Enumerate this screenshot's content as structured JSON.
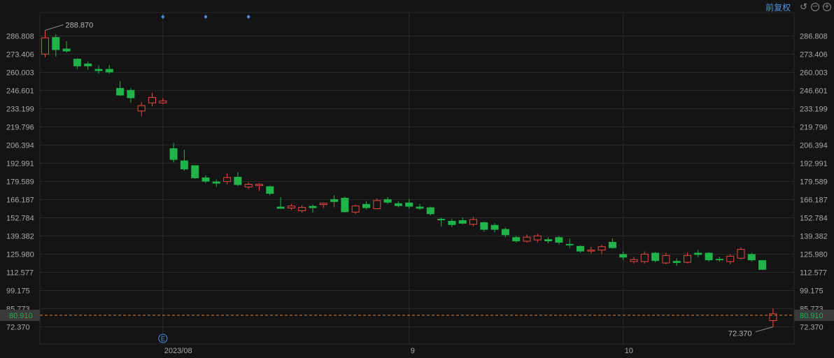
{
  "toolbar": {
    "mode_label": "前复权",
    "reset_icon": "undo-icon",
    "zoom_out_icon": "zoom-out-icon",
    "zoom_in_icon": "zoom-in-icon"
  },
  "chart_data": {
    "type": "candlestick",
    "ylim": [
      68,
      300
    ],
    "y_ticks": [
      "286.808",
      "273.406",
      "260.003",
      "246.601",
      "233.199",
      "219.796",
      "206.394",
      "192.991",
      "179.589",
      "166.187",
      "152.784",
      "139.382",
      "125.980",
      "112.577",
      "99.175",
      "85.773",
      "72.370"
    ],
    "x_tick_labels": [
      {
        "label": "2023/08",
        "index": 11
      },
      {
        "label": "9",
        "index": 34
      },
      {
        "label": "10",
        "index": 54
      }
    ],
    "current_price": "80.910",
    "max_label": "288.870",
    "min_label": "72.370",
    "event_marker": "E",
    "event_marker_index": 11,
    "top_markers": [
      11,
      15,
      19
    ],
    "colors": {
      "up": "#e8483f",
      "down": "#1fb34a",
      "grid": "#2a2a2a",
      "price_line": "#e07b3a",
      "marker": "#4a8fe8"
    },
    "candles": [
      {
        "o": 273.5,
        "h": 291.0,
        "l": 271.0,
        "c": 285.5
      },
      {
        "o": 286.0,
        "h": 288.0,
        "l": 271.5,
        "c": 276.5
      },
      {
        "o": 277.5,
        "h": 283.0,
        "l": 274.5,
        "c": 275.5
      },
      {
        "o": 270.0,
        "h": 270.5,
        "l": 262.5,
        "c": 264.5
      },
      {
        "o": 266.5,
        "h": 268.0,
        "l": 262.0,
        "c": 264.5
      },
      {
        "o": 262.5,
        "h": 265.0,
        "l": 259.0,
        "c": 261.0
      },
      {
        "o": 262.5,
        "h": 265.5,
        "l": 259.0,
        "c": 260.0
      },
      {
        "o": 248.5,
        "h": 253.5,
        "l": 242.5,
        "c": 243.0
      },
      {
        "o": 247.0,
        "h": 248.5,
        "l": 237.5,
        "c": 241.0
      },
      {
        "o": 231.5,
        "h": 238.0,
        "l": 227.5,
        "c": 235.5
      },
      {
        "o": 237.5,
        "h": 245.0,
        "l": 235.0,
        "c": 241.5
      },
      {
        "o": 237.5,
        "h": 241.0,
        "l": 236.5,
        "c": 239.0
      },
      {
        "o": 204.0,
        "h": 208.0,
        "l": 193.5,
        "c": 195.5
      },
      {
        "o": 195.0,
        "h": 203.0,
        "l": 187.5,
        "c": 188.5
      },
      {
        "o": 191.5,
        "h": 191.5,
        "l": 181.5,
        "c": 182.0
      },
      {
        "o": 182.5,
        "h": 184.0,
        "l": 178.5,
        "c": 179.5
      },
      {
        "o": 179.5,
        "h": 181.0,
        "l": 175.5,
        "c": 178.0
      },
      {
        "o": 179.5,
        "h": 185.5,
        "l": 177.5,
        "c": 182.5
      },
      {
        "o": 183.0,
        "h": 186.5,
        "l": 176.0,
        "c": 177.0
      },
      {
        "o": 175.5,
        "h": 179.0,
        "l": 174.0,
        "c": 177.5
      },
      {
        "o": 176.5,
        "h": 178.5,
        "l": 172.5,
        "c": 177.5
      },
      {
        "o": 176.0,
        "h": 176.5,
        "l": 169.5,
        "c": 170.5
      },
      {
        "o": 161.0,
        "h": 168.0,
        "l": 160.0,
        "c": 159.5
      },
      {
        "o": 160.0,
        "h": 163.0,
        "l": 158.5,
        "c": 161.5
      },
      {
        "o": 158.0,
        "h": 162.0,
        "l": 156.5,
        "c": 160.5
      },
      {
        "o": 161.5,
        "h": 162.5,
        "l": 156.5,
        "c": 160.0
      },
      {
        "o": 162.5,
        "h": 164.0,
        "l": 160.0,
        "c": 163.5
      },
      {
        "o": 166.5,
        "h": 169.5,
        "l": 160.5,
        "c": 164.5
      },
      {
        "o": 167.5,
        "h": 168.5,
        "l": 156.5,
        "c": 157.0
      },
      {
        "o": 157.0,
        "h": 162.5,
        "l": 155.5,
        "c": 161.5
      },
      {
        "o": 163.0,
        "h": 165.0,
        "l": 159.0,
        "c": 160.0
      },
      {
        "o": 159.5,
        "h": 167.0,
        "l": 159.0,
        "c": 165.5
      },
      {
        "o": 166.5,
        "h": 168.0,
        "l": 163.0,
        "c": 164.0
      },
      {
        "o": 163.5,
        "h": 165.0,
        "l": 160.5,
        "c": 161.5
      },
      {
        "o": 164.0,
        "h": 166.5,
        "l": 159.5,
        "c": 161.0
      },
      {
        "o": 161.0,
        "h": 163.0,
        "l": 158.5,
        "c": 159.5
      },
      {
        "o": 160.5,
        "h": 161.0,
        "l": 154.5,
        "c": 155.5
      },
      {
        "o": 152.0,
        "h": 153.0,
        "l": 146.5,
        "c": 151.0
      },
      {
        "o": 150.5,
        "h": 152.0,
        "l": 146.0,
        "c": 147.5
      },
      {
        "o": 151.0,
        "h": 153.0,
        "l": 148.0,
        "c": 148.5
      },
      {
        "o": 148.0,
        "h": 153.5,
        "l": 146.5,
        "c": 151.5
      },
      {
        "o": 149.5,
        "h": 150.0,
        "l": 142.5,
        "c": 144.0
      },
      {
        "o": 147.5,
        "h": 149.0,
        "l": 142.0,
        "c": 144.0
      },
      {
        "o": 144.5,
        "h": 145.5,
        "l": 138.5,
        "c": 140.0
      },
      {
        "o": 138.5,
        "h": 139.5,
        "l": 134.5,
        "c": 135.5
      },
      {
        "o": 135.5,
        "h": 140.5,
        "l": 134.5,
        "c": 138.5
      },
      {
        "o": 136.5,
        "h": 141.0,
        "l": 134.5,
        "c": 139.5
      },
      {
        "o": 137.0,
        "h": 138.5,
        "l": 134.0,
        "c": 135.5
      },
      {
        "o": 138.5,
        "h": 139.5,
        "l": 133.0,
        "c": 134.5
      },
      {
        "o": 133.5,
        "h": 137.5,
        "l": 130.5,
        "c": 132.5
      },
      {
        "o": 132.0,
        "h": 132.5,
        "l": 127.0,
        "c": 128.0
      },
      {
        "o": 128.5,
        "h": 131.5,
        "l": 126.5,
        "c": 129.0
      },
      {
        "o": 129.0,
        "h": 133.0,
        "l": 126.0,
        "c": 131.5
      },
      {
        "o": 135.0,
        "h": 137.5,
        "l": 130.0,
        "c": 130.5
      },
      {
        "o": 126.0,
        "h": 128.0,
        "l": 121.5,
        "c": 123.5
      },
      {
        "o": 120.5,
        "h": 124.0,
        "l": 119.0,
        "c": 122.0
      },
      {
        "o": 120.5,
        "h": 128.0,
        "l": 119.0,
        "c": 126.0
      },
      {
        "o": 127.0,
        "h": 127.5,
        "l": 120.0,
        "c": 121.0
      },
      {
        "o": 119.5,
        "h": 127.0,
        "l": 118.5,
        "c": 125.0
      },
      {
        "o": 121.0,
        "h": 123.0,
        "l": 117.5,
        "c": 119.5
      },
      {
        "o": 120.0,
        "h": 127.0,
        "l": 119.0,
        "c": 125.0
      },
      {
        "o": 127.0,
        "h": 129.0,
        "l": 123.5,
        "c": 125.5
      },
      {
        "o": 127.0,
        "h": 127.5,
        "l": 120.5,
        "c": 121.5
      },
      {
        "o": 122.5,
        "h": 124.0,
        "l": 120.5,
        "c": 121.5
      },
      {
        "o": 120.5,
        "h": 126.0,
        "l": 118.5,
        "c": 124.5
      },
      {
        "o": 123.0,
        "h": 131.0,
        "l": 122.0,
        "c": 129.5
      },
      {
        "o": 126.0,
        "h": 127.0,
        "l": 120.5,
        "c": 121.5
      },
      {
        "o": 121.5,
        "h": 121.5,
        "l": 114.5,
        "c": 114.5
      },
      {
        "o": 77.0,
        "h": 86.0,
        "l": 72.37,
        "c": 82.0
      }
    ]
  }
}
